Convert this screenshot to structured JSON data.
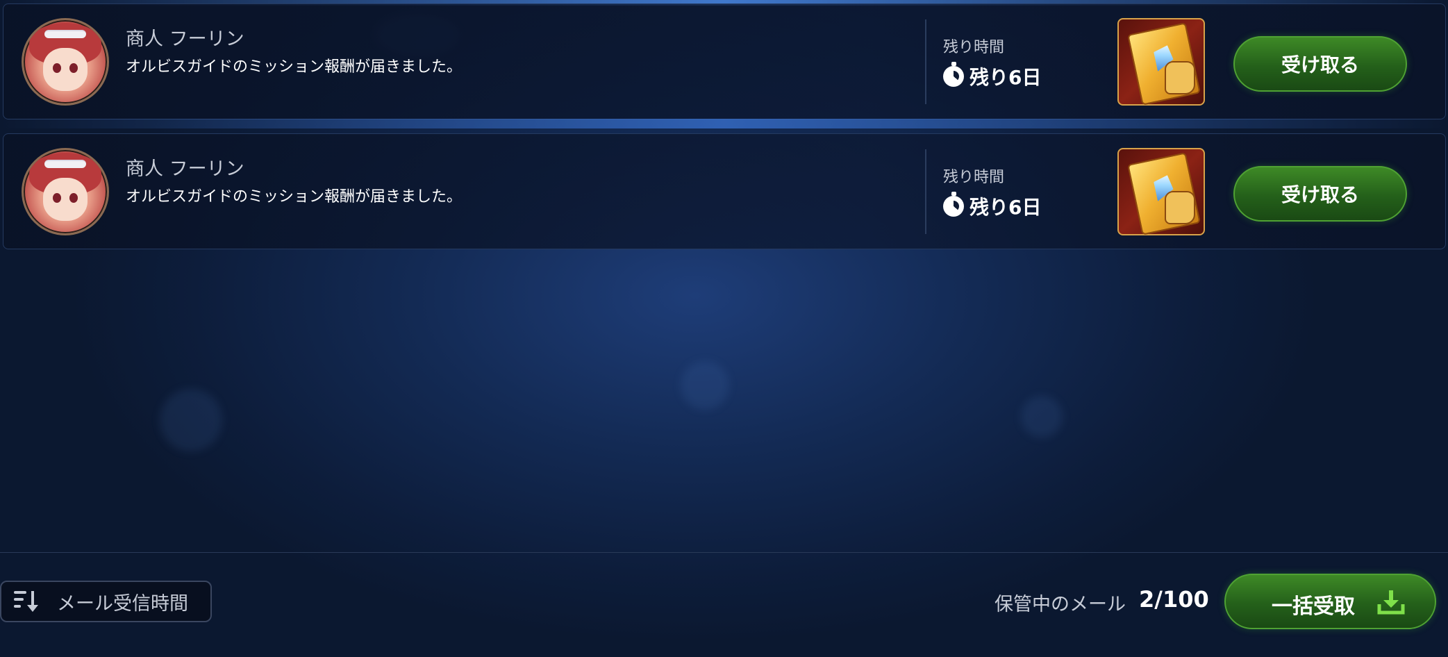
{
  "mails": [
    {
      "sender": "商人 フーリン",
      "message": "オルビスガイドのミッション報酬が届きました。",
      "remain_label": "残り時間",
      "remain_value": "残り6日",
      "receive_label": "受け取る",
      "avatar_icon": "merchant-portrait-icon",
      "reward_icon": "golden-guide-book-icon"
    },
    {
      "sender": "商人 フーリン",
      "message": "オルビスガイドのミッション報酬が届きました。",
      "remain_label": "残り時間",
      "remain_value": "残り6日",
      "receive_label": "受け取る",
      "avatar_icon": "merchant-portrait-icon",
      "reward_icon": "golden-guide-book-icon"
    }
  ],
  "footer": {
    "sort_label": "メール受信時間",
    "sort_icon": "sort-descending-icon",
    "storage_label": "保管中のメール",
    "storage_count": "2/100",
    "claim_all_label": "一括受取",
    "claim_all_icon": "download-icon"
  },
  "colors": {
    "button_green": "#2f7420",
    "download_icon_green": "#7fe04a",
    "background_navy": "#132a54"
  }
}
